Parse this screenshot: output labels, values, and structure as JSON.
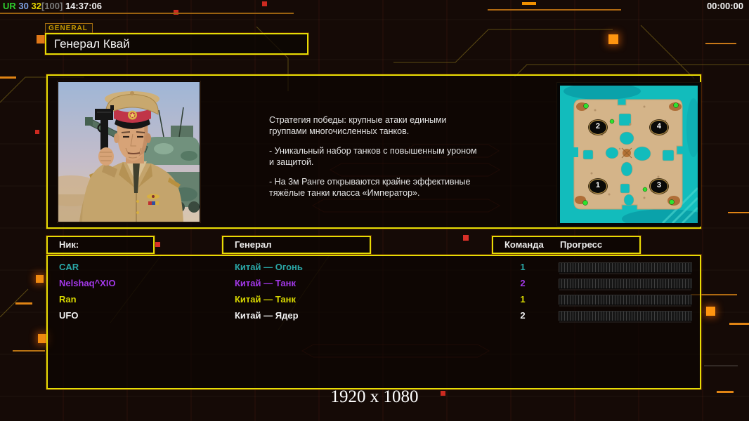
{
  "statusbar": {
    "ur": "UR",
    "val1": "30",
    "val2": "32",
    "val3": "[100]",
    "time": "14:37:06",
    "match_time": "00:00:00"
  },
  "header": {
    "tag": "GENERAL",
    "title": "Генерал Квай"
  },
  "info": {
    "paragraphs": [
      "Стратегия победы: крупные атаки едиными\n группами многочисленных танков.",
      "- Уникальный набор танков с повышенным уроном\n и защитой.",
      "- На 3м Ранге открываются крайне эффективные\n тяжёлые танки класса «Император»."
    ]
  },
  "minimap": {
    "markers": [
      {
        "n": "2",
        "x": 27.0,
        "y": 29.6
      },
      {
        "n": "4",
        "x": 71.4,
        "y": 29.6
      },
      {
        "n": "1",
        "x": 27.0,
        "y": 72.4
      },
      {
        "n": "3",
        "x": 71.4,
        "y": 72.4
      }
    ]
  },
  "table": {
    "headers": {
      "nick": "Ник:",
      "general": "Генерал",
      "team": "Команда",
      "progress": "Прогресс"
    },
    "rows": [
      {
        "nick": "CAR",
        "general": "Китай — Огонь",
        "team": "1",
        "color": "#2aa8a8"
      },
      {
        "nick": "Nelshaq^XIO",
        "general": "Китай — Танк",
        "team": "2",
        "color": "#a238e8"
      },
      {
        "nick": "Ran",
        "general": "Китай — Танк",
        "team": "1",
        "color": "#d8d800"
      },
      {
        "nick": "UFO",
        "general": "Китай — Ядер",
        "team": "2",
        "color": "#f0f0f0"
      }
    ]
  },
  "footer": {
    "resolution": "1920 x 1080"
  },
  "colors": {
    "border_yellow": "#e6dc05",
    "accent_orange": "#f08c00",
    "alert_red": "#d83028",
    "map_water": "#12bcbc",
    "map_sand": "#d4b489"
  }
}
